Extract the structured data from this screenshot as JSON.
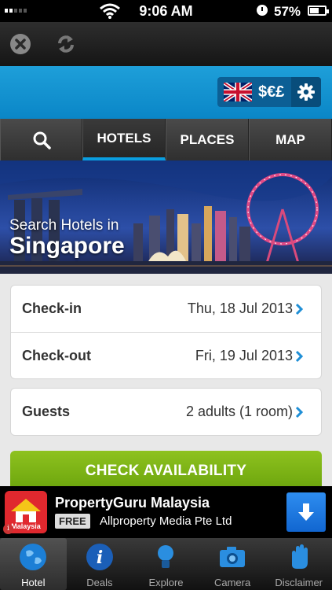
{
  "status_bar": {
    "time": "9:06 AM",
    "battery": "57%"
  },
  "header": {
    "currency_label": "$€£"
  },
  "tabs": [
    {
      "label": "HOTELS"
    },
    {
      "label": "PLACES"
    },
    {
      "label": "MAP"
    }
  ],
  "hero": {
    "subtitle": "Search Hotels in",
    "city": "Singapore"
  },
  "booking": {
    "checkin_label": "Check-in",
    "checkin_value": "Thu, 18 Jul 2013",
    "checkout_label": "Check-out",
    "checkout_value": "Fri, 19 Jul 2013",
    "guests_label": "Guests",
    "guests_value": "2 adults (1 room)"
  },
  "cta": {
    "label": "CHECK AVAILABILITY"
  },
  "ad": {
    "title": "PropertyGuru Malaysia",
    "free_badge": "FREE",
    "publisher": "Allproperty Media Pte Ltd",
    "logo_text": "Malaysia"
  },
  "tab_bar": [
    {
      "label": "Hotel"
    },
    {
      "label": "Deals"
    },
    {
      "label": "Explore"
    },
    {
      "label": "Camera"
    },
    {
      "label": "Disclaimer"
    }
  ],
  "colors": {
    "accent_blue": "#0a9ee0",
    "cta_green": "#7cb518",
    "ad_red": "#e0282e"
  }
}
